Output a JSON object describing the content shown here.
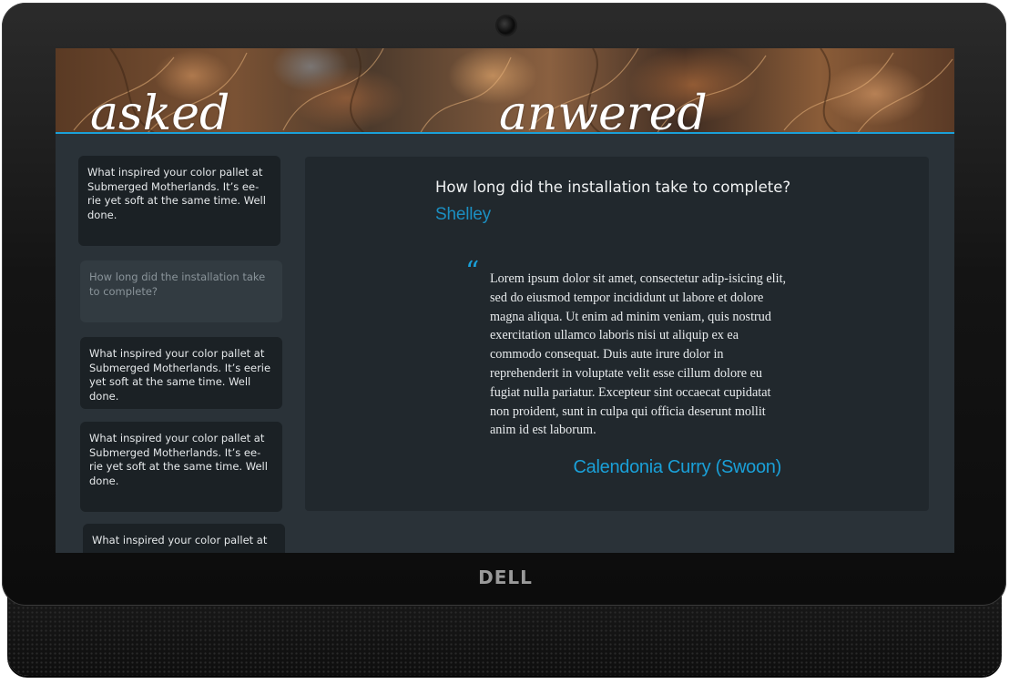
{
  "device": {
    "brand": "DELL"
  },
  "banner": {
    "left_word": "asked",
    "right_word": "anwered",
    "accent_color": "#1aa0d8"
  },
  "questions": [
    {
      "text": "What inspired your color pallet at Submerged Motherlands. It’s ee-rie yet soft at the same time. Well done.",
      "active": false
    },
    {
      "text": "How long did the installation take to complete?",
      "active": true
    },
    {
      "text": "What inspired your color pallet at Submerged Motherlands. It’s eerie yet soft at the same time. Well done.",
      "active": false
    },
    {
      "text": "What inspired your color pallet at Submerged Motherlands. It’s ee-rie yet soft at the same time. Well done.",
      "active": false
    },
    {
      "text": "What inspired your color pallet at",
      "active": false
    }
  ],
  "detail": {
    "question": "How long did the installation take to complete?",
    "asker": "Shelley",
    "quote_glyph": "“",
    "answer": "Lorem ipsum dolor sit amet, consectetur adip-isicing elit, sed do eiusmod tempor incididunt ut labore et dolore magna aliqua. Ut enim ad minim veniam, quis nostrud exercitation ullamco laboris nisi ut aliquip ex ea commodo consequat. Duis aute irure dolor in reprehenderit in voluptate velit esse cillum dolore eu fugiat nulla pariatur. Excepteur sint occaecat cupidatat non proident, sunt in culpa qui officia deserunt mollit anim id est laborum.",
    "answerer": "Calendonia Curry (Swoon)"
  }
}
